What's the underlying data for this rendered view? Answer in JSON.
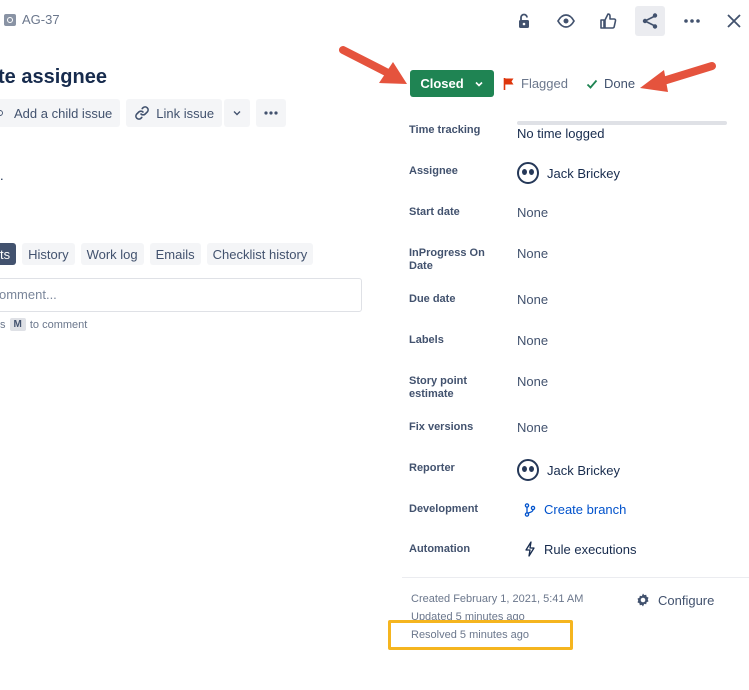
{
  "issue": {
    "key": "AG-37",
    "title": "te assignee"
  },
  "actions": {
    "add_child": "Add a child issue",
    "link_issue": "Link issue"
  },
  "description_fragment": ".",
  "activity": {
    "tabs": [
      "ts",
      "History",
      "Work log",
      "Emails",
      "Checklist history"
    ],
    "comment_placeholder": "omment...",
    "tip_prefix": "s",
    "tip_key": "M",
    "tip_suffix": "to comment"
  },
  "status": {
    "current": "Closed",
    "flag_label": "Flagged",
    "resolution": "Done",
    "colors": {
      "status_bg": "#1f8453",
      "flag": "#de350b",
      "done_check": "#1f8453"
    }
  },
  "fields": {
    "time_tracking": {
      "label": "Time tracking",
      "value": "No time logged"
    },
    "assignee": {
      "label": "Assignee",
      "value": "Jack Brickey"
    },
    "start_date": {
      "label": "Start date",
      "value": "None"
    },
    "inprogress_on_date": {
      "label": "InProgress On Date",
      "value": "None"
    },
    "due_date": {
      "label": "Due date",
      "value": "None"
    },
    "labels": {
      "label": "Labels",
      "value": "None"
    },
    "story_points": {
      "label": "Story point estimate",
      "value": "None"
    },
    "fix_versions": {
      "label": "Fix versions",
      "value": "None"
    },
    "reporter": {
      "label": "Reporter",
      "value": "Jack Brickey"
    },
    "development": {
      "label": "Development",
      "value": "Create branch"
    },
    "automation": {
      "label": "Automation",
      "value": "Rule executions"
    }
  },
  "footer": {
    "created": "Created February 1, 2021, 5:41 AM",
    "updated": "Updated 5 minutes ago",
    "resolved": "Resolved 5 minutes ago",
    "configure": "Configure"
  },
  "annotations": {
    "arrow_color": "#e5533d",
    "highlight_color": "#f5b51f"
  },
  "icons": [
    "lock-icon",
    "eye-icon",
    "thumbs-up-icon",
    "share-icon",
    "more-icon",
    "close-icon",
    "child-issue-icon",
    "link-icon",
    "chevron-down-icon",
    "flag-icon",
    "check-icon",
    "branch-icon",
    "lightning-icon",
    "gear-icon"
  ]
}
